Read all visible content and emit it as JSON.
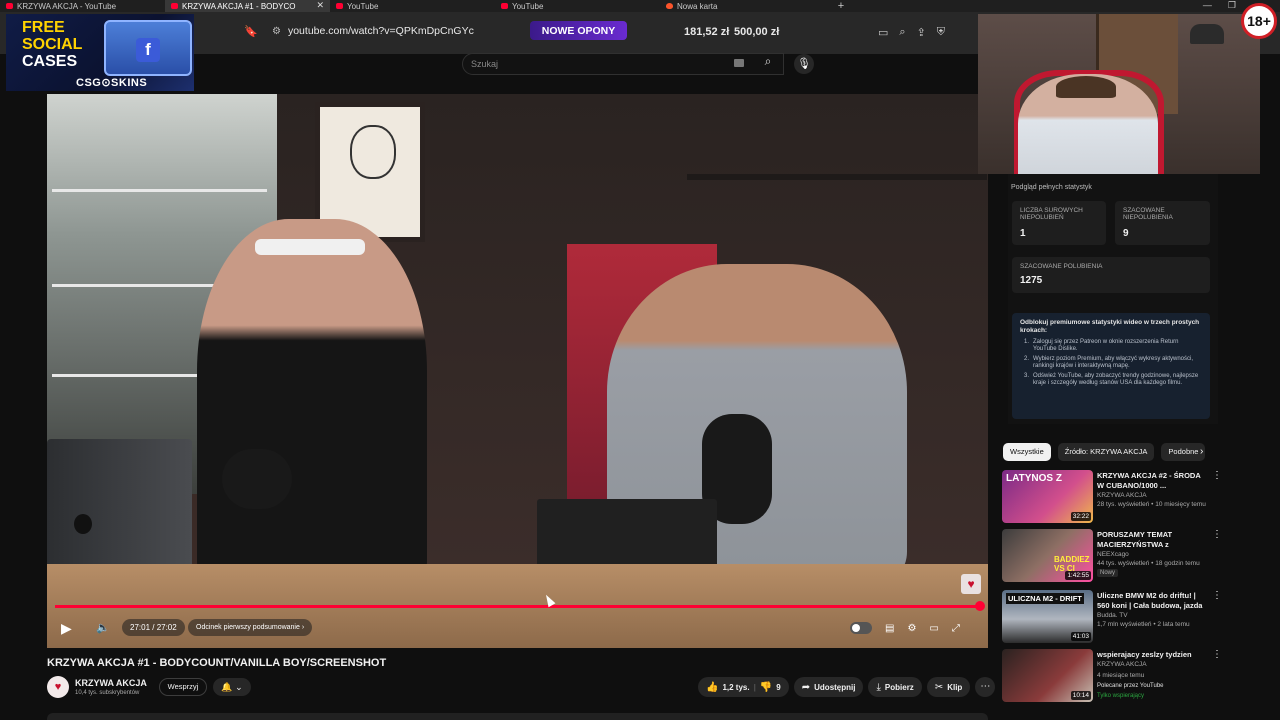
{
  "browser": {
    "tabs": [
      {
        "label": "KRZYWA AKCJA - YouTube",
        "active": false
      },
      {
        "label": "KRZYWA AKCJA #1 - BODYCO",
        "active": true
      },
      {
        "label": "YouTube",
        "active": false
      },
      {
        "label": "YouTube",
        "active": false
      },
      {
        "label": "Nowa karta",
        "active": false
      }
    ],
    "new_tab": "+",
    "url": "youtube.com/watch?v=QPKmDpCnGYc"
  },
  "promo": {
    "button": "NOWE OPONY",
    "balance_1": "181,52 zł",
    "balance_2": "500,00 zł"
  },
  "ad_overlay": {
    "line1": "FREE",
    "line2": "SOCIAL",
    "line3": "CASES",
    "brand": "CSG⊙SKINS"
  },
  "search": {
    "placeholder": "Szukaj"
  },
  "player": {
    "time": "27:01 / 27:02",
    "chapter": "Odcinek pierwszy podsumowanie",
    "progress_fraction": 0.999
  },
  "video": {
    "title": "KRZYWA AKCJA #1 - BODYCOUNT/VANILLA BOY/SCREENSHOT",
    "channel": "KRZYWA AKCJA",
    "subscribers": "10,4 tys. subskrybentów",
    "support_label": "Wesprzyj",
    "likes": "1,2 tys.",
    "dislikes": "9",
    "share_label": "Udostępnij",
    "download_label": "Pobierz",
    "clip_label": "Klip"
  },
  "stats": {
    "header": "Podgląd pełnych statystyk",
    "raw_dislikes_label": "LICZBA SUROWYCH NIEPOLUBIEŃ",
    "raw_dislikes_value": "1",
    "est_dislikes_label": "SZACOWANE NIEPOLUBIENIA",
    "est_dislikes_value": "9",
    "est_likes_label": "SZACOWANE POLUBIENIA",
    "est_likes_value": "1275",
    "unlock_title": "Odblokuj premiumowe statystyki wideo w trzech prostych krokach:",
    "steps": [
      "Zaloguj się przez Patreon w oknie rozszerzenia Return YouTube Dislike.",
      "Wybierz poziom Premium, aby włączyć wykresy aktywności, rankingi krajów i interaktywną mapę.",
      "Odśwież YouTube, aby zobaczyć trendy godzinowe, najlepsze kraje i szczegóły według stanów USA dla każdego filmu."
    ]
  },
  "chips": [
    "Wszystkie",
    "Źródło: KRZYWA AKCJA",
    "Podobne"
  ],
  "recommendations": [
    {
      "title": "KRZYWA AKCJA #2 - ŚRODA W CUBANO/1000 ...",
      "channel": "KRZYWA AKCJA",
      "meta": "28 tys. wyświetleń • 10 miesięcy temu",
      "badge": "",
      "duration": "32:22",
      "thumb_text": "LATYNOS Z"
    },
    {
      "title": "PORUSZAMY TEMAT MACIERZYŃSTWA z BADDIEZ!...",
      "channel": "NEEXcago",
      "meta": "44 tys. wyświetleń • 18 godzin temu",
      "badge": "Nowy",
      "duration": "1:42:55",
      "thumb_text": "BADDIEZ VS CI"
    },
    {
      "title": "Uliczne BMW M2 do driftu! | 560 koni | Cała budowa, jazda po ...",
      "channel": "Budda. TV",
      "meta": "1,7 mln wyświetleń • 2 lata temu",
      "badge": "",
      "duration": "41:03",
      "thumb_text": "ULICZNA M2 - DRIFT"
    },
    {
      "title": "wspierajacy zeslzy tydzien",
      "channel": "KRZYWA AKCJA",
      "meta": "4 miesiące temu",
      "badge": "Polecane przez YouTube",
      "badge2": "Tylko wspierający",
      "duration": "10:14",
      "thumb_text": ""
    }
  ],
  "age_badge": "18+",
  "colors": {
    "accent": "#ff0033",
    "background": "#0f0f0f",
    "promo": "#6a2bd0"
  }
}
